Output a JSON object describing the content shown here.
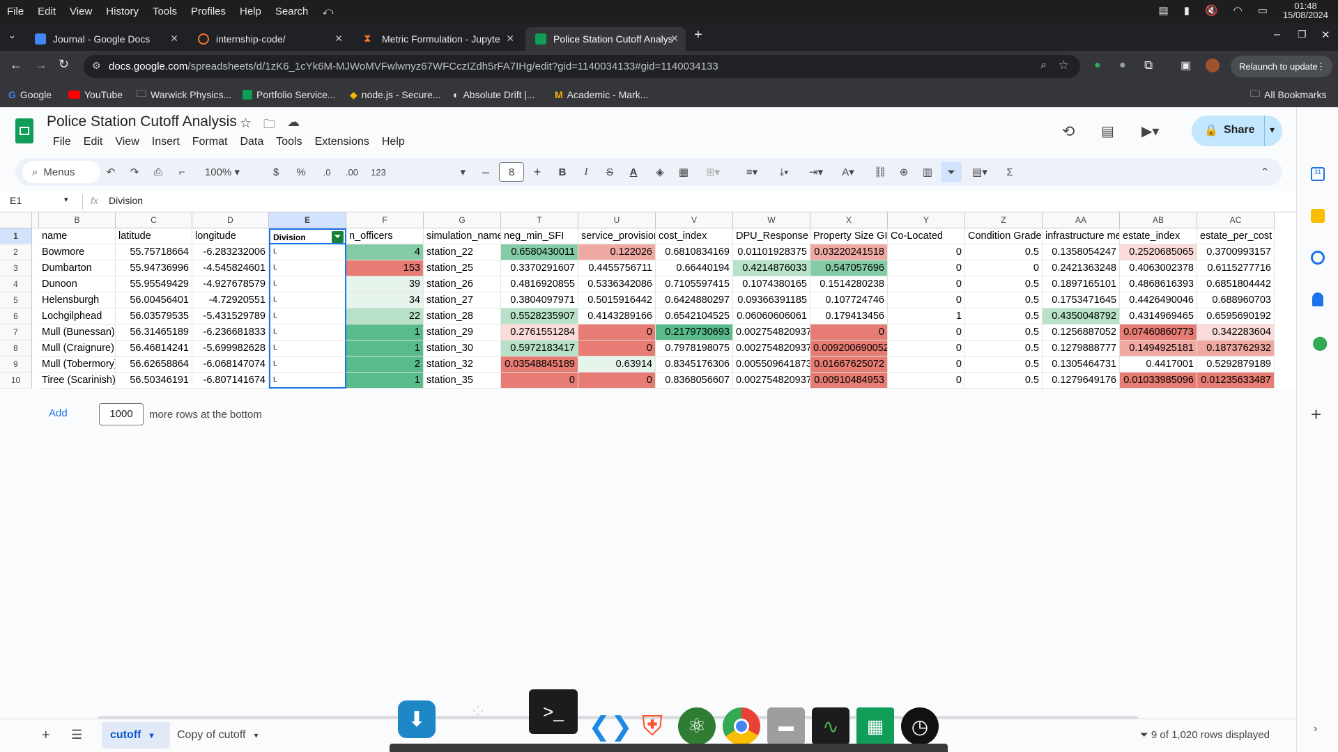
{
  "system": {
    "menu": [
      "File",
      "Edit",
      "View",
      "History",
      "Tools",
      "Profiles",
      "Help",
      "Search"
    ],
    "time": "01:48",
    "date": "15/08/2024"
  },
  "tabs": [
    {
      "title": "Journal - Google Docs",
      "color": "#4285f4"
    },
    {
      "title": "internship-code/",
      "color": "#f37626"
    },
    {
      "title": "Metric Formulation - Jupyte",
      "color": "#f37626"
    },
    {
      "title": "Police Station Cutoff Analys",
      "color": "#0f9d58"
    }
  ],
  "address": {
    "host": "docs.google.com",
    "path": "/spreadsheets/d/1zK6_1cYk6M-MJWoMVFwlwnyz67WFCczIZdh5rFA7IHg/edit?gid=1140034133#gid=1140034133",
    "relaunch": "Relaunch to update"
  },
  "bookmarks": [
    "Google",
    "YouTube",
    "Warwick Physics...",
    "Portfolio Service...",
    "node.js - Secure...",
    "Absolute Drift |...",
    "Academic - Mark...",
    "All Bookmarks"
  ],
  "doc": {
    "title": "Police Station Cutoff Analysis",
    "menu": [
      "File",
      "Edit",
      "View",
      "Insert",
      "Format",
      "Data",
      "Tools",
      "Extensions",
      "Help"
    ],
    "share": "Share"
  },
  "toolbar": {
    "menus": "Menus",
    "zoom": "100%",
    "currency": "$",
    "percent": "%",
    "dec_less": ".0",
    "dec_more": ".00",
    "format123": "123",
    "font_size": "8",
    "bold": "B",
    "italic": "I",
    "strike": "S",
    "text_color": "A",
    "sigma": "Σ"
  },
  "formula": {
    "ref": "E1",
    "fx": "fx",
    "value": "Division"
  },
  "columns": [
    "B",
    "C",
    "D",
    "E",
    "F",
    "G",
    "T",
    "U",
    "V",
    "W",
    "X",
    "Y",
    "Z",
    "AA",
    "AB",
    "AC"
  ],
  "header_row": [
    "name",
    "latitude",
    "longitude",
    "Division",
    "n_officers",
    "simulation_name",
    "neg_min_SFI",
    "service_provision",
    "cost_index",
    "DPU_Response",
    "Property Size GI",
    "Co-Located",
    "Condition Grade",
    "infrastructure me",
    "estate_index",
    "estate_per_cost"
  ],
  "row_numbers": [
    "1",
    "2",
    "3",
    "4",
    "5",
    "6",
    "7",
    "8",
    "9",
    "10"
  ],
  "rows": [
    [
      "Bowmore",
      "55.75718664",
      "-6.283232006",
      "L",
      "4",
      "station_22",
      "0.6580430011",
      "0.122026",
      "0.6810834169",
      "0.01101928375",
      "0.03220241518",
      "0",
      "0.5",
      "0.1358054247",
      "0.2520685065",
      "0.3700993157"
    ],
    [
      "Dumbarton",
      "55.94736996",
      "-4.545824601",
      "L",
      "153",
      "station_25",
      "0.3370291607",
      "0.4455756711",
      "0.66440194",
      "0.4214876033",
      "0.547057696",
      "0",
      "0",
      "0.2421363248",
      "0.4063002378",
      "0.6115277716"
    ],
    [
      "Dunoon",
      "55.95549429",
      "-4.927678579",
      "L",
      "39",
      "station_26",
      "0.4816920855",
      "0.5336342086",
      "0.7105597415",
      "0.1074380165",
      "0.1514280238",
      "0",
      "0.5",
      "0.1897165101",
      "0.4868616393",
      "0.6851804442"
    ],
    [
      "Helensburgh",
      "56.00456401",
      "-4.72920551",
      "L",
      "34",
      "station_27",
      "0.3804097971",
      "0.5015916442",
      "0.6424880297",
      "0.09366391185",
      "0.107724746",
      "0",
      "0.5",
      "0.1753471645",
      "0.4426490046",
      "0.688960703"
    ],
    [
      "Lochgilphead",
      "56.03579535",
      "-5.431529789",
      "L",
      "22",
      "station_28",
      "0.5528235907",
      "0.4143289166",
      "0.6542104525",
      "0.06060606061",
      "0.179413456",
      "1",
      "0.5",
      "0.4350048792",
      "0.4314969465",
      "0.6595690192"
    ],
    [
      "Mull (Bunessan)",
      "56.31465189",
      "-6.236681833",
      "L",
      "1",
      "station_29",
      "0.2761551284",
      "0",
      "0.2179730693",
      "0.002754820937",
      "0",
      "0",
      "0.5",
      "0.1256887052",
      "0.07460860773",
      "0.342283604"
    ],
    [
      "Mull (Craignure)",
      "56.46814241",
      "-5.699982628",
      "L",
      "1",
      "station_30",
      "0.5972183417",
      "0",
      "0.7978198075",
      "0.002754820937",
      "0.009200690052",
      "0",
      "0.5",
      "0.1279888777",
      "0.1494925181",
      "0.1873762932"
    ],
    [
      "Mull (Tobermory)",
      "56.62658864",
      "-6.068147074",
      "L",
      "2",
      "station_32",
      "0.03548845189",
      "0.63914",
      "0.8345176306",
      "0.005509641873",
      "0.01667625072",
      "0",
      "0.5",
      "0.1305464731",
      "0.4417001",
      "0.5292879189"
    ],
    [
      "Tiree (Scarinish)",
      "56.50346191",
      "-6.807141674",
      "L",
      "1",
      "station_35",
      "0",
      "0",
      "0.8368056607",
      "0.002754820937",
      "0.00910484953",
      "0",
      "0.5",
      "0.1279649176",
      "0.01033985096",
      "0.01235633487"
    ]
  ],
  "fills": [
    [
      "",
      "",
      "",
      "",
      "g2",
      "",
      "g2",
      "r2",
      "",
      "",
      "r2",
      "",
      "",
      "",
      "r3",
      ""
    ],
    [
      "",
      "",
      "",
      "",
      "r1",
      "",
      "",
      "",
      "",
      "g3",
      "g2",
      "",
      "",
      "",
      "",
      ""
    ],
    [
      "",
      "",
      "",
      "",
      "g4",
      "",
      "",
      "",
      "",
      "",
      "",
      "",
      "",
      "",
      "",
      ""
    ],
    [
      "",
      "",
      "",
      "",
      "g4",
      "",
      "",
      "",
      "",
      "",
      "",
      "",
      "",
      "",
      "",
      ""
    ],
    [
      "",
      "",
      "",
      "",
      "g3",
      "",
      "g3",
      "",
      "",
      "",
      "",
      "",
      "",
      "g3",
      "",
      ""
    ],
    [
      "",
      "",
      "",
      "",
      "g1",
      "",
      "r3",
      "r1",
      "g1",
      "",
      "r1",
      "",
      "",
      "",
      "r1",
      "r3"
    ],
    [
      "",
      "",
      "",
      "",
      "g1",
      "",
      "g3",
      "r1",
      "",
      "",
      "r1",
      "",
      "",
      "",
      "r2",
      "r2"
    ],
    [
      "",
      "",
      "",
      "",
      "g1",
      "",
      "r1",
      "g4",
      "",
      "",
      "r1",
      "",
      "",
      "",
      "",
      ""
    ],
    [
      "",
      "",
      "",
      "",
      "g1",
      "",
      "r1",
      "r1",
      "",
      "",
      "r1",
      "",
      "",
      "",
      "r1",
      "r1"
    ]
  ],
  "add_rows": {
    "button": "Add",
    "count": "1000",
    "suffix": "more rows at the bottom"
  },
  "sheets": [
    "cutoff",
    "Copy of cutoff"
  ],
  "status": "9 of 1,020 rows displayed"
}
